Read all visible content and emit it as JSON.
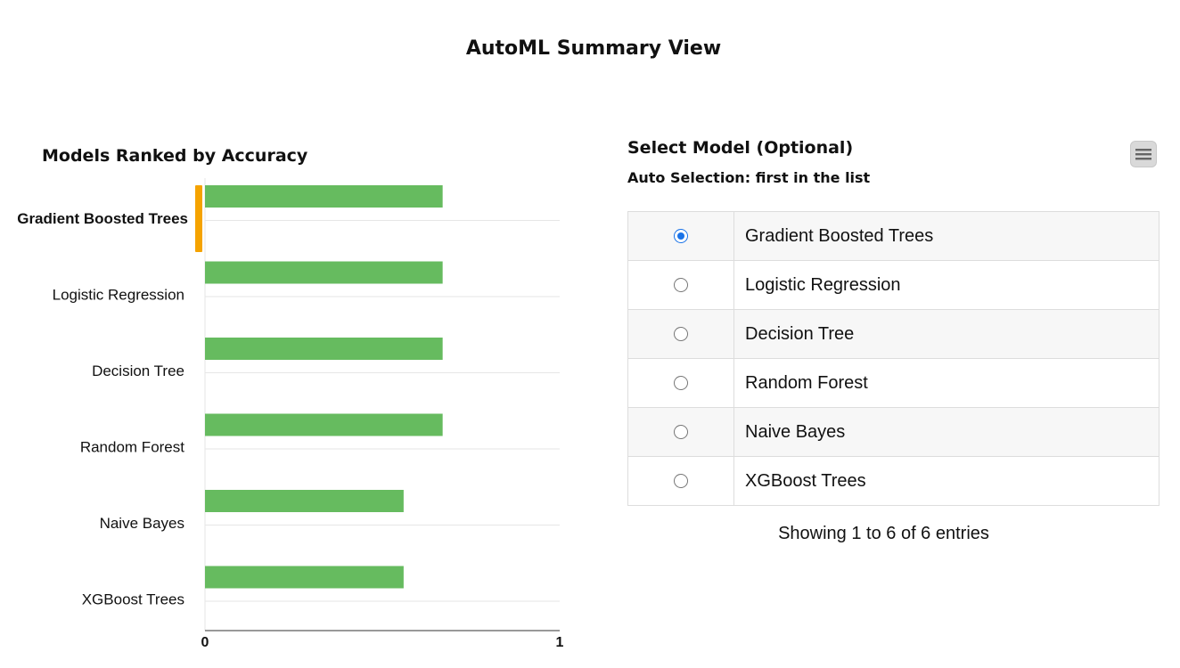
{
  "page": {
    "title": "AutoML Summary View"
  },
  "chart_data": {
    "type": "bar",
    "orientation": "horizontal",
    "title": "Models Ranked by Accuracy",
    "categories": [
      "Gradient Boosted Trees",
      "Logistic Regression",
      "Decision Tree",
      "Random Forest",
      "Naive Bayes",
      "XGBoost Trees"
    ],
    "values": [
      0.67,
      0.67,
      0.67,
      0.67,
      0.56,
      0.56
    ],
    "xlim": [
      0,
      1
    ],
    "xticks": [
      "0",
      "1"
    ],
    "highlighted": "Gradient Boosted Trees",
    "bar_color": "#66bb5f",
    "highlight_color": "#f5a300",
    "grid": true
  },
  "panel": {
    "title": "Select Model (Optional)",
    "subtitle": "Auto Selection: first in the list",
    "menu_icon": "hamburger-menu-icon",
    "rows": [
      {
        "label": "Gradient Boosted Trees",
        "selected": true
      },
      {
        "label": "Logistic Regression",
        "selected": false
      },
      {
        "label": "Decision Tree",
        "selected": false
      },
      {
        "label": "Random Forest",
        "selected": false
      },
      {
        "label": "Naive Bayes",
        "selected": false
      },
      {
        "label": "XGBoost Trees",
        "selected": false
      }
    ],
    "info": "Showing 1 to 6 of 6 entries",
    "accent_color": "#1a73e8"
  }
}
